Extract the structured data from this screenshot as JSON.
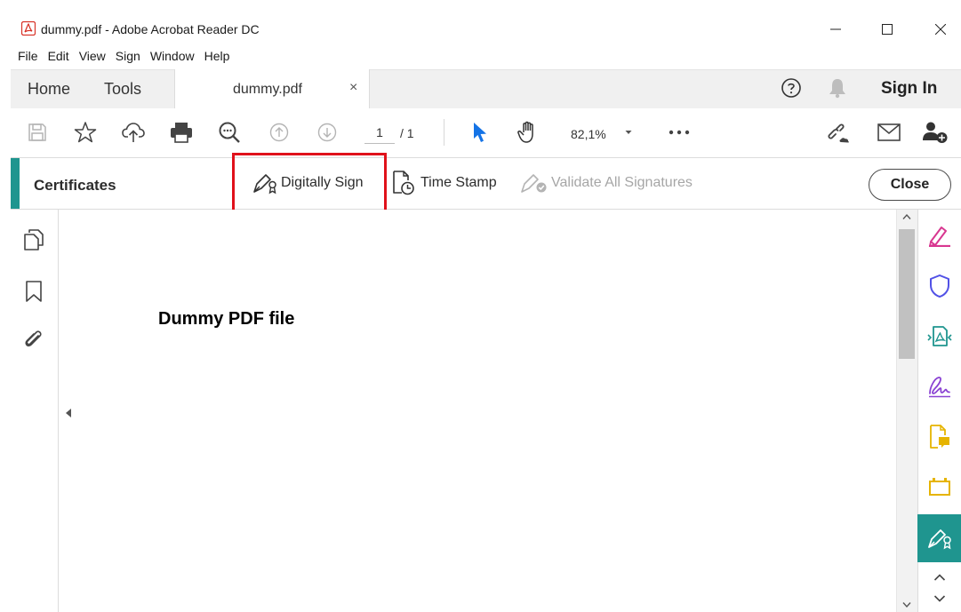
{
  "window": {
    "title": "dummy.pdf - Adobe Acrobat Reader DC"
  },
  "menu": {
    "items": [
      "File",
      "Edit",
      "View",
      "Sign",
      "Window",
      "Help"
    ]
  },
  "tabs": {
    "home": "Home",
    "tools": "Tools",
    "document": "dummy.pdf",
    "close_glyph": "×",
    "sign_in": "Sign In"
  },
  "toolbar": {
    "page_current": "1",
    "page_total": "/ 1",
    "zoom": "82,1%"
  },
  "certificates": {
    "title": "Certificates",
    "digitally_sign": "Digitally Sign",
    "time_stamp": "Time Stamp",
    "validate_all": "Validate All Signatures",
    "close": "Close"
  },
  "document": {
    "heading": "Dummy PDF file"
  },
  "colors": {
    "accent_teal": "#1f958f",
    "highlight_red": "#e0111b",
    "acrobat_red": "#d62b20"
  }
}
